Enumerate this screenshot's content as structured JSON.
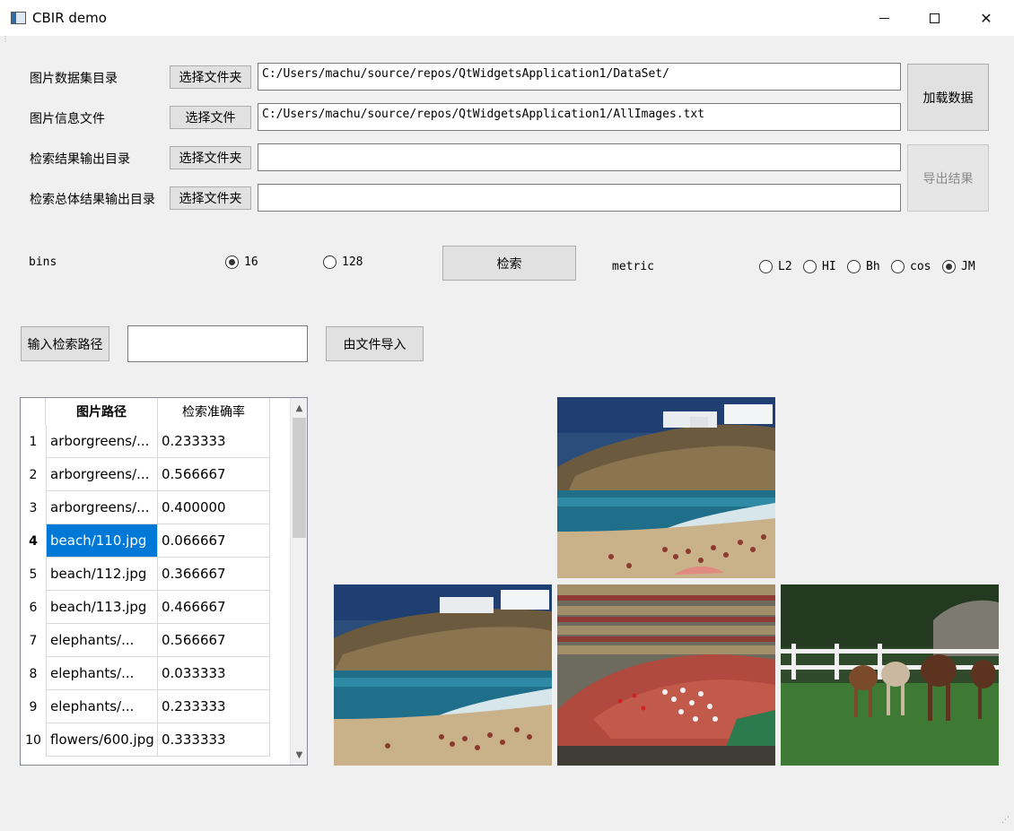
{
  "window": {
    "title": "CBIR demo",
    "app_icon": "app-window-icon",
    "minimize_icon": "minimize-icon",
    "maximize_icon": "maximize-icon",
    "close_icon": "close-icon",
    "close_glyph": "✕"
  },
  "paths": {
    "dataset_dir_label": "图片数据集目录",
    "dataset_dir_button": "选择文件夹",
    "dataset_dir_value": "C:/Users/machu/source/repos/QtWidgetsApplication1/DataSet/",
    "info_file_label": "图片信息文件",
    "info_file_button": "选择文件",
    "info_file_value": "C:/Users/machu/source/repos/QtWidgetsApplication1/AllImages.txt",
    "result_dir_label": "检索结果输出目录",
    "result_dir_button": "选择文件夹",
    "result_dir_value": "",
    "overall_dir_label": "检索总体结果输出目录",
    "overall_dir_button": "选择文件夹",
    "overall_dir_value": "",
    "load_button": "加载数据",
    "export_button": "导出结果"
  },
  "options": {
    "bins_label": "bins",
    "bins_options": [
      {
        "label": "16",
        "selected": true
      },
      {
        "label": "128",
        "selected": false
      }
    ],
    "search_button": "检索",
    "metric_label": "metric",
    "metric_options": [
      {
        "label": "L2",
        "selected": false
      },
      {
        "label": "HI",
        "selected": false
      },
      {
        "label": "Bh",
        "selected": false
      },
      {
        "label": "cos",
        "selected": false
      },
      {
        "label": "JM",
        "selected": true
      }
    ]
  },
  "query": {
    "input_path_button": "输入检索路径",
    "input_value": "",
    "import_button": "由文件导入"
  },
  "results_table": {
    "columns": [
      "图片路径",
      "检索准确率"
    ],
    "rows": [
      {
        "num": "1",
        "path": "arborgreens/...",
        "accuracy": "0.233333",
        "selected": false
      },
      {
        "num": "2",
        "path": "arborgreens/...",
        "accuracy": "0.566667",
        "selected": false
      },
      {
        "num": "3",
        "path": "arborgreens/...",
        "accuracy": "0.400000",
        "selected": false
      },
      {
        "num": "4",
        "path": "beach/110.jpg",
        "accuracy": "0.066667",
        "selected": true
      },
      {
        "num": "5",
        "path": "beach/112.jpg",
        "accuracy": "0.366667",
        "selected": false
      },
      {
        "num": "6",
        "path": "beach/113.jpg",
        "accuracy": "0.466667",
        "selected": false
      },
      {
        "num": "7",
        "path": "elephants/...",
        "accuracy": "0.566667",
        "selected": false
      },
      {
        "num": "8",
        "path": "elephants/...",
        "accuracy": "0.033333",
        "selected": false
      },
      {
        "num": "9",
        "path": "elephants/...",
        "accuracy": "0.233333",
        "selected": false
      },
      {
        "num": "10",
        "path": "flowers/600.jpg",
        "accuracy": "0.333333",
        "selected": false
      }
    ]
  },
  "images": {
    "query_image": "beach-cliff-photo",
    "results": [
      "beach-cliff-photo",
      "stadium-parade-photo",
      "horses-pasture-photo"
    ]
  },
  "colors": {
    "selection": "#0078d7",
    "window_bg": "#f0f0f0",
    "sea": "#1f6f8b",
    "sand": "#c9b28a",
    "track": "#b04a3e",
    "grass": "#3f7a35"
  }
}
